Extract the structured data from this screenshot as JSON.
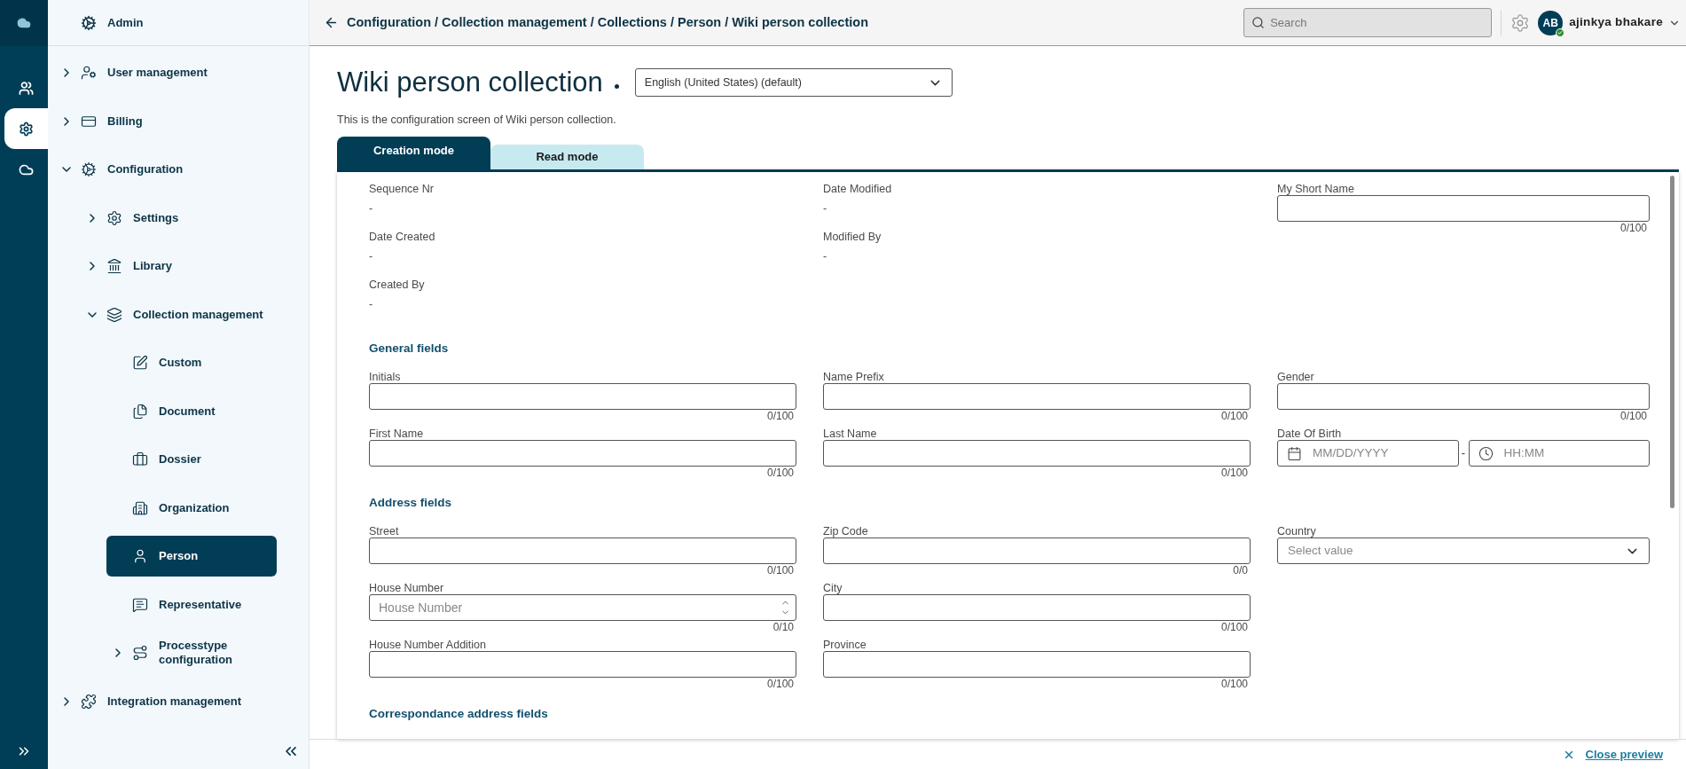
{
  "rail": {
    "items": [
      {
        "selected": false
      },
      {
        "selected": true
      },
      {
        "selected": false
      }
    ]
  },
  "sidebar": {
    "title": "Admin",
    "items": [
      {
        "label": "User management",
        "expanded": false
      },
      {
        "label": "Billing",
        "expanded": false
      },
      {
        "label": "Configuration",
        "expanded": true,
        "children": [
          {
            "label": "Settings",
            "expanded": false
          },
          {
            "label": "Library",
            "expanded": false
          },
          {
            "label": "Collection management",
            "expanded": true,
            "children": [
              {
                "label": "Custom",
                "selected": false
              },
              {
                "label": "Document",
                "selected": false
              },
              {
                "label": "Dossier",
                "selected": false
              },
              {
                "label": "Organization",
                "selected": false
              },
              {
                "label": "Person",
                "selected": true
              },
              {
                "label": "Representative",
                "selected": false
              },
              {
                "label": "Processtype configuration",
                "expanded": false,
                "selected": false
              }
            ]
          }
        ]
      },
      {
        "label": "Integration management",
        "expanded": false
      }
    ]
  },
  "topbar": {
    "breadcrumb": "Configuration / Collection management / Collections / Person / Wiki person collection",
    "search": {
      "placeholder": "Search"
    },
    "user": {
      "initials": "AB",
      "name": "ajinkya bhakare",
      "online": true
    }
  },
  "page": {
    "title": "Wiki person collection",
    "modified": true,
    "language": "English (United States) (default)",
    "description": "This is the configuration screen of Wiki person collection."
  },
  "tabs": [
    {
      "label": "Creation mode",
      "selected": true
    },
    {
      "label": "Read mode",
      "selected": false
    }
  ],
  "meta_columns": [
    [
      {
        "kind": "readonly",
        "label": "Sequence Nr",
        "value": "-"
      },
      {
        "kind": "readonly",
        "label": "Date Created",
        "value": "-"
      },
      {
        "kind": "readonly",
        "label": "Created By",
        "value": "-"
      }
    ],
    [
      {
        "kind": "readonly",
        "label": "Date Modified",
        "value": "-"
      },
      {
        "kind": "readonly",
        "label": "Modified By",
        "value": "-"
      }
    ],
    [
      {
        "kind": "text",
        "label": "My Short Name",
        "counter": "0/100"
      }
    ]
  ],
  "sections": [
    {
      "title": "General fields",
      "rows": [
        [
          {
            "kind": "text",
            "label": "Initials",
            "counter": "0/100"
          },
          {
            "kind": "text",
            "label": "Name Prefix",
            "counter": "0/100"
          },
          {
            "kind": "text",
            "label": "Gender",
            "counter": "0/100"
          }
        ],
        [
          {
            "kind": "text",
            "label": "First Name",
            "counter": "0/100"
          },
          {
            "kind": "text",
            "label": "Last Name",
            "counter": "0/100"
          },
          {
            "kind": "date",
            "label": "Date Of Birth",
            "date_placeholder": "MM/DD/YYYY",
            "separator": "-",
            "time_placeholder": "HH:MM"
          }
        ]
      ]
    },
    {
      "title": "Address fields",
      "rows": [
        [
          {
            "kind": "text",
            "label": "Street",
            "counter": "0/100"
          },
          {
            "kind": "text",
            "label": "Zip Code",
            "counter": "0/0"
          },
          {
            "kind": "select",
            "label": "Country",
            "placeholder": "Select value"
          }
        ],
        [
          {
            "kind": "number",
            "label": "House Number",
            "placeholder": "House Number",
            "counter": "0/10"
          },
          {
            "kind": "text",
            "label": "City",
            "counter": "0/100"
          }
        ],
        [
          {
            "kind": "text",
            "label": "House Number Addition",
            "counter": "0/100"
          },
          {
            "kind": "text",
            "label": "Province",
            "counter": "0/100"
          }
        ]
      ]
    },
    {
      "title": "Correspondance address fields"
    }
  ],
  "footer": {
    "close_preview": "Close preview"
  }
}
